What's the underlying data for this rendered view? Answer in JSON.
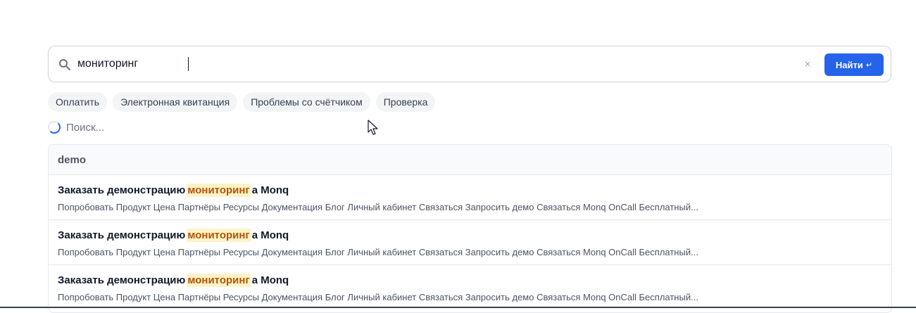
{
  "search": {
    "value": "мониторинг",
    "clear_label": "×",
    "button_label": "Найти",
    "button_icon": "↵"
  },
  "chips": [
    {
      "label": "Оплатить"
    },
    {
      "label": "Электронная квитанция"
    },
    {
      "label": "Проблемы со счётчиком"
    },
    {
      "label": "Проверка"
    }
  ],
  "status": {
    "loading_text": "Поиск..."
  },
  "results": {
    "group_name": "demo",
    "items": [
      {
        "title_before": "Заказать демонстрацию",
        "title_highlight": "мониторинг",
        "title_after": "а Monq",
        "snippet": "Попробовать Продукт Цена Партнёры Ресурсы Документация Блог Личный кабинет Связаться Запросить демо Связаться Monq OnCall Бесплатный..."
      },
      {
        "title_before": "Заказать демонстрацию",
        "title_highlight": "мониторинг",
        "title_after": "а Monq",
        "snippet": "Попробовать Продукт Цена Партнёры Ресурсы Документация Блог Личный кабинет Связаться Запросить демо Связаться Monq OnCall Бесплатный..."
      },
      {
        "title_before": "Заказать демонстрацию",
        "title_highlight": "мониторинг",
        "title_after": "а Monq",
        "snippet": "Попробовать Продукт Цена Партнёры Ресурсы Документация Блог Личный кабинет Связаться Запросить демо Связаться Monq OnCall Бесплатный..."
      }
    ]
  },
  "colors": {
    "accent": "#2563eb",
    "highlight_bg": "#fef3c7",
    "highlight_text": "#b45309"
  },
  "icons": {
    "search": "search-icon",
    "clear": "close-icon",
    "enter": "enter-icon",
    "spinner": "spinner-icon",
    "cursor": "mouse-cursor-icon"
  }
}
